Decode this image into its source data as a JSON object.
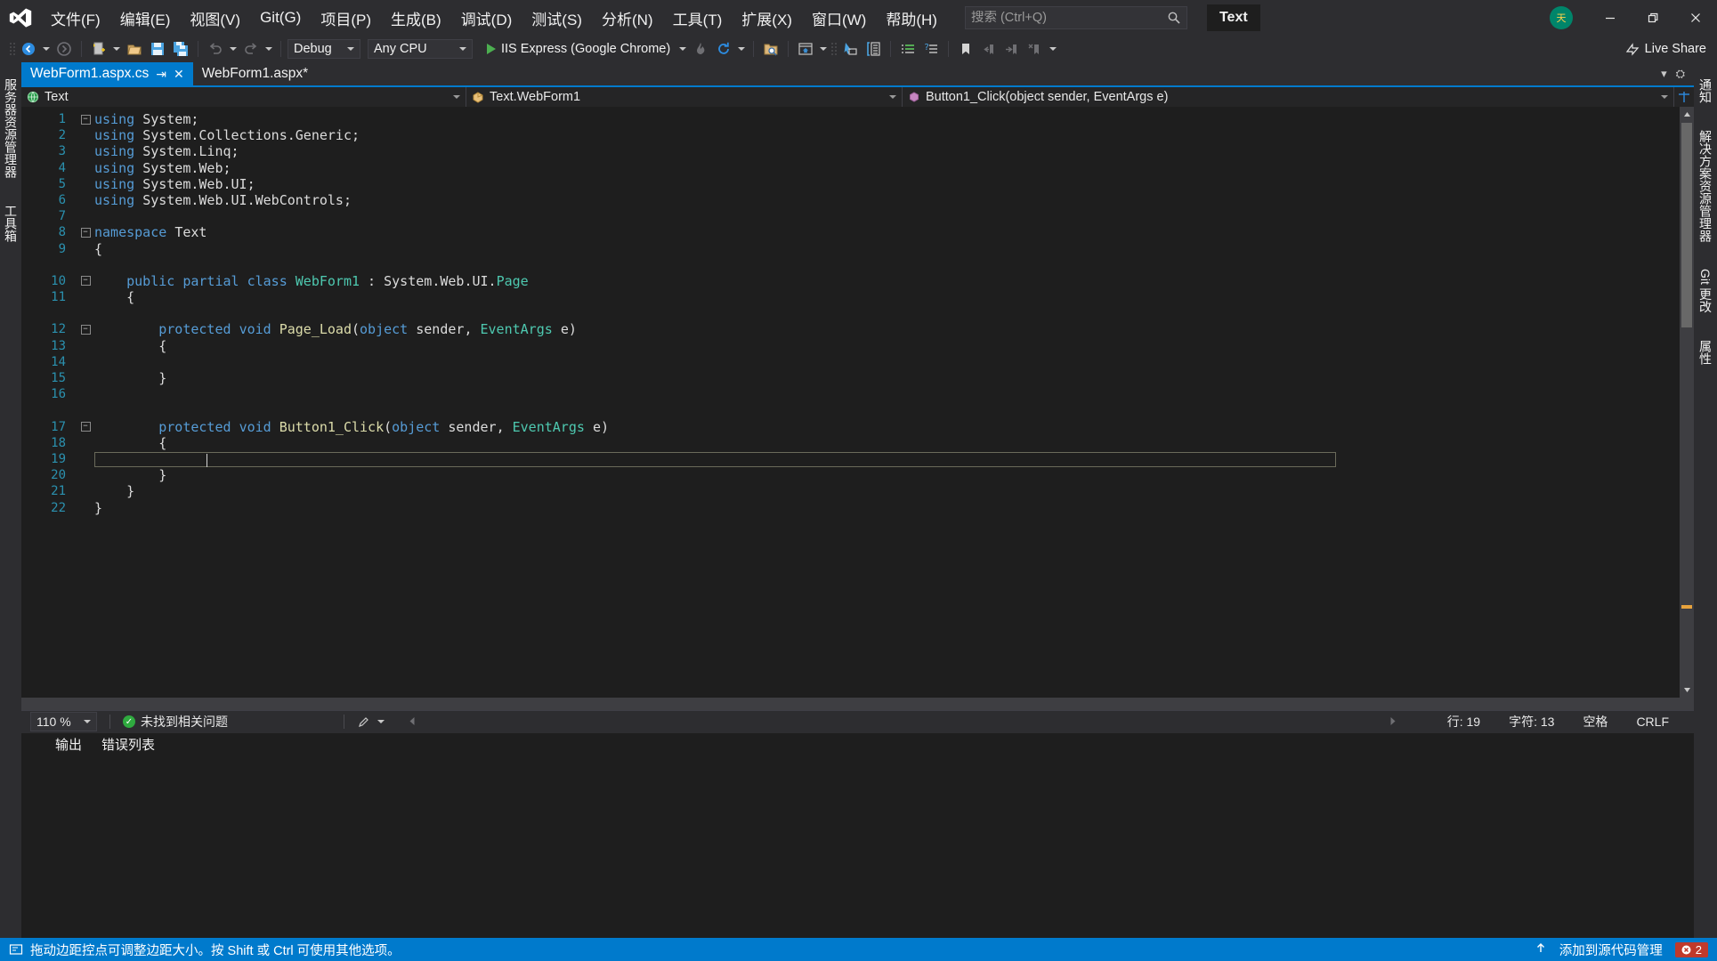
{
  "app": {
    "title": "Text",
    "logo_icon": "visual-studio-logo-icon"
  },
  "menu": {
    "items": [
      {
        "label": "文件(F)",
        "accel": "F"
      },
      {
        "label": "编辑(E)",
        "accel": "E"
      },
      {
        "label": "视图(V)",
        "accel": "V"
      },
      {
        "label": "Git(G)",
        "accel": "G"
      },
      {
        "label": "项目(P)",
        "accel": "P"
      },
      {
        "label": "生成(B)",
        "accel": "B"
      },
      {
        "label": "调试(D)",
        "accel": "D"
      },
      {
        "label": "测试(S)",
        "accel": "S"
      },
      {
        "label": "分析(N)",
        "accel": "N"
      },
      {
        "label": "工具(T)",
        "accel": "T"
      },
      {
        "label": "扩展(X)",
        "accel": "X"
      },
      {
        "label": "窗口(W)",
        "accel": "W"
      },
      {
        "label": "帮助(H)",
        "accel": "H"
      }
    ]
  },
  "search": {
    "placeholder": "搜索 (Ctrl+Q)",
    "value": "",
    "icon": "search-icon"
  },
  "window_controls": {
    "avatar_text": "天",
    "minimize": "—",
    "restore": "❐",
    "close": "✕"
  },
  "toolbar": {
    "nav_back_icon": "navigate-back-icon",
    "nav_forward_icon": "navigate-forward-icon",
    "new_project_icon": "new-project-icon",
    "open_file_icon": "open-file-icon",
    "save_icon": "save-icon",
    "save_all_icon": "save-all-icon",
    "undo_icon": "undo-icon",
    "redo_icon": "redo-icon",
    "config_label": "Debug",
    "platform_label": "Any CPU",
    "run_label": "IIS Express (Google Chrome)",
    "hot_reload_icon": "hot-reload-icon",
    "refresh_icon": "refresh-icon",
    "solution_explorer_icon": "search-folder-icon",
    "preview_icon": "browser-preview-icon",
    "select_element_icon": "select-element-icon",
    "toolbox_icon": "toolbox-icon",
    "comment_icon": "comment-lines-icon",
    "uncomment_icon": "uncomment-lines-icon",
    "bookmark_icon": "bookmark-icon",
    "prev_bookmark_icon": "previous-bookmark-icon",
    "next_bookmark_icon": "next-bookmark-icon",
    "clear_bookmark_icon": "clear-bookmarks-icon",
    "live_share_label": "Live Share",
    "live_share_icon": "live-share-icon"
  },
  "left_dock": {
    "items": [
      {
        "label": "服务器资源管理器"
      },
      {
        "label": "工具箱"
      }
    ]
  },
  "right_dock": {
    "items": [
      {
        "label": "通知"
      },
      {
        "label": "解决方案资源管理器"
      },
      {
        "label": "Git 更改"
      },
      {
        "label": "属性"
      }
    ]
  },
  "tabs": {
    "items": [
      {
        "label": "WebForm1.aspx.cs",
        "active": true,
        "pin_icon": "pin-icon",
        "close_icon": "close-icon"
      },
      {
        "label": "WebForm1.aspx*",
        "active": false
      }
    ],
    "overflow_icon": "chevron-down-icon",
    "settings_icon": "gear-icon"
  },
  "navbar": {
    "project": "Text",
    "project_icon": "project-globe-icon",
    "type": "Text.WebForm1",
    "type_icon": "class-icon",
    "member": "Button1_Click(object sender, EventArgs e)",
    "member_icon": "method-icon",
    "split_icon": "split-view-icon"
  },
  "code": {
    "lines": [
      {
        "n": "1",
        "fold": "minus",
        "text": "using System;"
      },
      {
        "n": "2",
        "fold": "",
        "text": "using System.Collections.Generic;"
      },
      {
        "n": "3",
        "fold": "",
        "text": "using System.Linq;"
      },
      {
        "n": "4",
        "fold": "",
        "text": "using System.Web;"
      },
      {
        "n": "5",
        "fold": "",
        "text": "using System.Web.UI;"
      },
      {
        "n": "6",
        "fold": "",
        "text": "using System.Web.UI.WebControls;"
      },
      {
        "n": "7",
        "fold": "",
        "text": ""
      },
      {
        "n": "8",
        "fold": "minus",
        "text": "namespace Text"
      },
      {
        "n": "9",
        "fold": "",
        "text": "{"
      },
      {
        "n": "",
        "fold": "",
        "text": ""
      },
      {
        "n": "10",
        "fold": "minus",
        "text": "    public partial class WebForm1 : System.Web.UI.Page"
      },
      {
        "n": "11",
        "fold": "",
        "text": "    {"
      },
      {
        "n": "",
        "fold": "",
        "text": ""
      },
      {
        "n": "12",
        "fold": "minus",
        "text": "        protected void Page_Load(object sender, EventArgs e)"
      },
      {
        "n": "13",
        "fold": "",
        "text": "        {"
      },
      {
        "n": "14",
        "fold": "",
        "text": ""
      },
      {
        "n": "15",
        "fold": "",
        "text": "        }"
      },
      {
        "n": "16",
        "fold": "",
        "text": ""
      },
      {
        "n": "",
        "fold": "",
        "text": ""
      },
      {
        "n": "17",
        "fold": "minus",
        "text": "        protected void Button1_Click(object sender, EventArgs e)"
      },
      {
        "n": "18",
        "fold": "",
        "text": "        {"
      },
      {
        "n": "19",
        "fold": "",
        "text": "            "
      },
      {
        "n": "20",
        "fold": "",
        "text": "        }"
      },
      {
        "n": "21",
        "fold": "",
        "text": "    }"
      },
      {
        "n": "22",
        "fold": "",
        "text": "}"
      }
    ]
  },
  "editor_status": {
    "zoom": "110 %",
    "issues": "未找到相关问题",
    "issues_icon": "check-circle-icon",
    "pen_icon": "pen-icon",
    "line": "行: 19",
    "column": "字符: 13",
    "spaces": "空格",
    "eol": "CRLF"
  },
  "output_panel": {
    "tabs": [
      "输出",
      "错误列表"
    ]
  },
  "footer": {
    "icon": "info-icon",
    "message": "拖动边距控点可调整边距大小。按 Shift 或 Ctrl 可使用其他选项。",
    "source_control": "添加到源代码管理",
    "source_control_icon": "upload-icon",
    "error_count": "2",
    "error_icon": "error-icon"
  },
  "colors": {
    "accent": "#007acc",
    "titlebar_bg": "#2d2d30",
    "editor_bg": "#1e1e1e",
    "keyword": "#569cd6",
    "type": "#4ec9b0",
    "method": "#dcdcaa",
    "param": "#9cdcfe",
    "linenum": "#2b91af",
    "error_red": "#c0392b",
    "ok_green": "#2faa3f"
  }
}
